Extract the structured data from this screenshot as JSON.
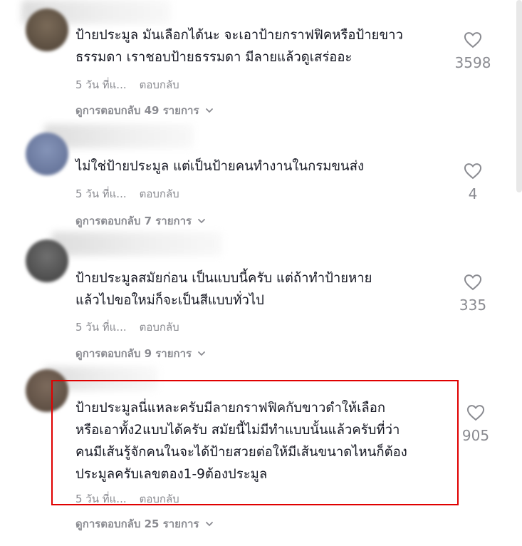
{
  "comments": [
    {
      "text": "ป้ายประมูล มันเลือกได้นะ จะเอาป้ายกราฟฟิคหรือป้ายขาว\nธรรมดา เราชอบป้ายธรรมดา มีลายแล้วดูเสร่ออะ",
      "time": "5 วัน ที่แ...",
      "reply_label": "ตอบกลับ",
      "view_replies": "ดูการตอบกลับ 49 รายการ",
      "likes": "3598"
    },
    {
      "text": "ไม่ใช่ป้ายประมูล แต่เป็นป้ายคนทำงานในกรมขนส่ง",
      "time": "5 วัน ที่แ...",
      "reply_label": "ตอบกลับ",
      "view_replies": "ดูการตอบกลับ 7 รายการ",
      "likes": "4"
    },
    {
      "text": "ป้ายประมูลสมัยก่อน เป็นแบบนี้ครับ แต่ถ้าทำป้ายหาย\nแล้วไปขอใหม่ก็จะเป็นสีแบบทั่วไป",
      "time": "5 วัน ที่แ...",
      "reply_label": "ตอบกลับ",
      "view_replies": "ดูการตอบกลับ 9 รายการ",
      "likes": "335"
    },
    {
      "text": "ป้ายประมูลนี่แหละครับมีลายกราฟฟิคกับขาวดำให้เลือก\nหรือเอาทั้ง2แบบได้ครับ สมัยนี้ไม่มีทำแบบนั้นแล้วครับที่ว่า\nคนมีเส้นรู้จักคนในจะได้ป้ายสวยต่อให้มีเส้นขนาดไหนก็ต้อง\nประมูลครับเลขตอง1-9ต้องประมูล",
      "time": "5 วัน ที่แ...",
      "reply_label": "ตอบกลับ",
      "view_replies": "ดูการตอบกลับ 25 รายการ",
      "likes": "905"
    }
  ],
  "icons": {
    "like": "heart-outline-icon",
    "expand": "chevron-down-icon"
  },
  "colors": {
    "highlight": "#e00000",
    "muted": "#8a8b91",
    "text": "#161823"
  }
}
